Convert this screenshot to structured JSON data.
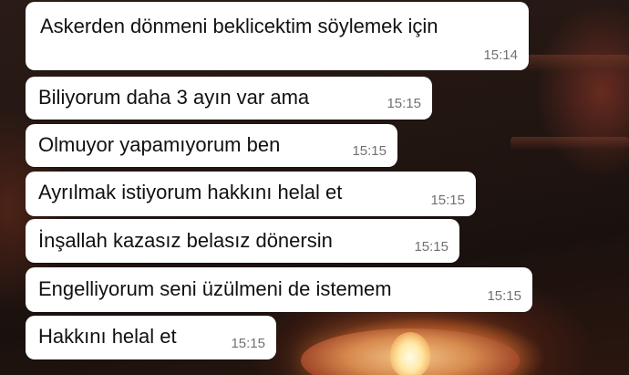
{
  "chat": {
    "messages": [
      {
        "text": "Askerden dönmeni beklicektim söylemek için",
        "time": "15:14"
      },
      {
        "text": "Biliyorum daha 3 ayın var ama",
        "time": "15:15"
      },
      {
        "text": "Olmuyor yapamıyorum ben",
        "time": "15:15"
      },
      {
        "text": "Ayrılmak istiyorum hakkını helal et",
        "time": "15:15"
      },
      {
        "text": "İnşallah kazasız belasız dönersin",
        "time": "15:15"
      },
      {
        "text": "Engelliyorum seni üzülmeni de istemem",
        "time": "15:15"
      },
      {
        "text": "Hakkını helal et",
        "time": "15:15"
      }
    ]
  },
  "colors": {
    "bubble_background": "#ffffff",
    "message_text": "#111111",
    "timestamp_text": "#6f7172"
  }
}
